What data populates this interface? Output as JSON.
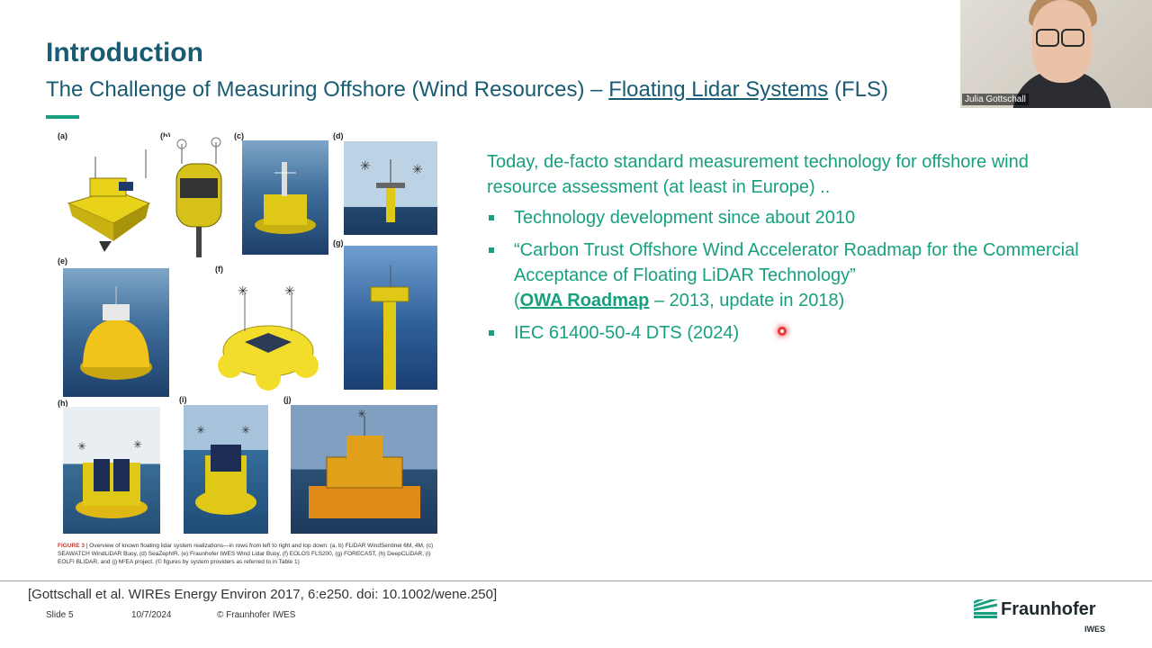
{
  "slide": {
    "title": "Introduction",
    "subtitle_pre": "The Challenge of Measuring Offshore (Wind Resources) – ",
    "subtitle_link": "Floating Lidar Systems",
    "subtitle_post": " (FLS)"
  },
  "figure": {
    "panel_labels": [
      "(a)",
      "(b)",
      "(c)",
      "(d)",
      "(e)",
      "(f)",
      "(g)",
      "(h)",
      "(i)",
      "(j)"
    ],
    "caption_label": "FIGURE 3",
    "caption_text": " | Overview of known floating lidar system realizations—in rows from left to right and top down: (a, b) FLiDAR WindSentinel 6M, 4M, (c) SEAWATCH WindLiDAR Buoy, (d) SeaZephIR, (e) Fraunhofer IWES Wind Lidar Buoy, (f) EOLOS FLS200, (g) FORECAST, (h) DeepCLiDAR, (i) EOLFI BLIDAR, and (j) M²EA project. (© figures by system providers as referred to in Table 1)"
  },
  "content": {
    "intro": "Today, de-facto standard measurement technology for offshore wind resource assessment (at least in Europe) ..",
    "bullet1": "Technology development since about 2010",
    "bullet2": "“Carbon Trust Offshore Wind Accelerator Roadmap for the Commercial Acceptance of Floating LiDAR Technology”",
    "bullet2_pre": "(",
    "bullet2_link": "OWA Roadmap",
    "bullet2_post": " – 2013, update in 2018)",
    "bullet3": "IEC 61400-50-4 DTS (2024)"
  },
  "video": {
    "participant_name": "Julia Gottschall"
  },
  "footer": {
    "citation": "[Gottschall et al. WIREs Energy Environ 2017, 6:e250. doi: 10.1002/wene.250]",
    "slide_number": "Slide 5",
    "date": "10/7/2024",
    "copyright": "© Fraunhofer IWES",
    "logo_text": "Fraunhofer",
    "logo_sub": "IWES"
  },
  "colors": {
    "title": "#1a5b74",
    "accent": "#17a07f",
    "pointer": "#e53935"
  }
}
